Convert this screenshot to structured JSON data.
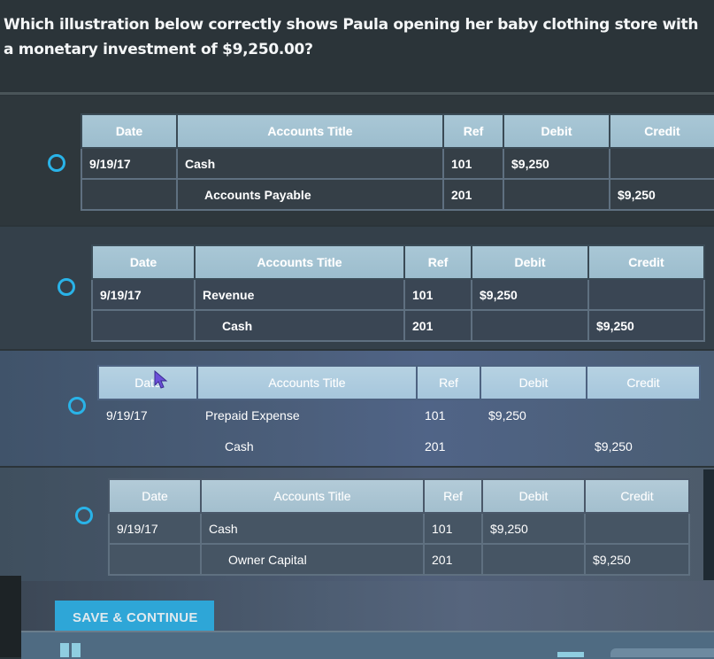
{
  "question": {
    "text": "Which illustration below correctly shows Paula opening her baby clothing store with a monetary investment of $9,250.00?"
  },
  "table_headers": [
    "Date",
    "Accounts Title",
    "Ref",
    "Debit",
    "Credit"
  ],
  "options": [
    {
      "id": "option-1",
      "selected": false,
      "headers": [
        "Date",
        "Accounts Title",
        "Ref",
        "Debit",
        "Credit"
      ],
      "rows": [
        {
          "date": "9/19/17",
          "account": "Cash",
          "ref": "101",
          "debit": "$9,250",
          "credit": ""
        },
        {
          "date": "",
          "account": "Accounts Payable",
          "ref": "201",
          "debit": "",
          "credit": "$9,250"
        }
      ]
    },
    {
      "id": "option-2",
      "selected": false,
      "headers": [
        "Date",
        "Accounts Title",
        "Ref",
        "Debit",
        "Credit"
      ],
      "rows": [
        {
          "date": "9/19/17",
          "account": "Revenue",
          "ref": "101",
          "debit": "$9,250",
          "credit": ""
        },
        {
          "date": "",
          "account": "Cash",
          "ref": "201",
          "debit": "",
          "credit": "$9,250"
        }
      ]
    },
    {
      "id": "option-3",
      "selected": false,
      "headers": [
        "Date",
        "Accounts Title",
        "Ref",
        "Debit",
        "Credit"
      ],
      "rows": [
        {
          "date": "9/19/17",
          "account": "Prepaid Expense",
          "ref": "101",
          "debit": "$9,250",
          "credit": ""
        },
        {
          "date": "",
          "account": "Cash",
          "ref": "201",
          "debit": "",
          "credit": "$9,250"
        }
      ]
    },
    {
      "id": "option-4",
      "selected": false,
      "headers": [
        "Date",
        "Accounts Title",
        "Ref",
        "Debit",
        "Credit"
      ],
      "rows": [
        {
          "date": "9/19/17",
          "account": "Cash",
          "ref": "101",
          "debit": "$9,250",
          "credit": ""
        },
        {
          "date": "",
          "account": "Owner Capital",
          "ref": "201",
          "debit": "",
          "credit": "$9,250"
        }
      ]
    }
  ],
  "actions": {
    "save_label": "SAVE & CONTINUE"
  },
  "colors": {
    "accent": "#2ea6d7",
    "radio": "#29b3e8",
    "header_bg": "#a9c7d6",
    "background": "#2b3439"
  },
  "icons": {
    "radio": "radio-unselected-icon",
    "cursor": "mouse-pointer-icon",
    "pause": "pause-icon"
  }
}
